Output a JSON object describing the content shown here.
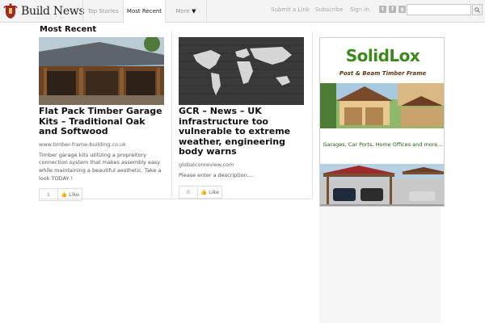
{
  "header": {
    "site_name": "Build News",
    "tabs": [
      {
        "label": "Top Stories"
      },
      {
        "label": "Most Recent"
      },
      {
        "label": "More"
      }
    ],
    "links": {
      "submit": "Submit a Link",
      "subscribe": "Subscribe",
      "signin": "Sign in"
    },
    "social_icons": [
      "twitter-icon",
      "facebook-icon",
      "google-plus-icon"
    ],
    "search": {
      "value": "",
      "placeholder": ""
    }
  },
  "section_title": "Most Recent",
  "articles": [
    {
      "title": "Flat Pack Timber Garage Kits – Traditional Oak and Softwood",
      "source": "www.timber-frame-building.co.uk",
      "description": "Timber garage kits utilizing a propreitory connection system that makes assembly easy while maintaining a beautiful aesthetic. Take a look TODAY !",
      "likes": "1",
      "like_label": "Like"
    },
    {
      "title": "GCR – News – UK infrastructure too vulnerable to extreme weather, engineering body warns",
      "source": "globalconreview.com",
      "description": "Please enter a description....",
      "likes": "0",
      "like_label": "Like"
    }
  ],
  "ad": {
    "brand": "SolidLox",
    "subtitle": "Post & Beam Timber Frame",
    "caption": "Garages, Car Ports, Home Offices and more..."
  },
  "colors": {
    "ad_brand": "#3b8a1b",
    "topbar_bg": "#f4f4f4"
  }
}
